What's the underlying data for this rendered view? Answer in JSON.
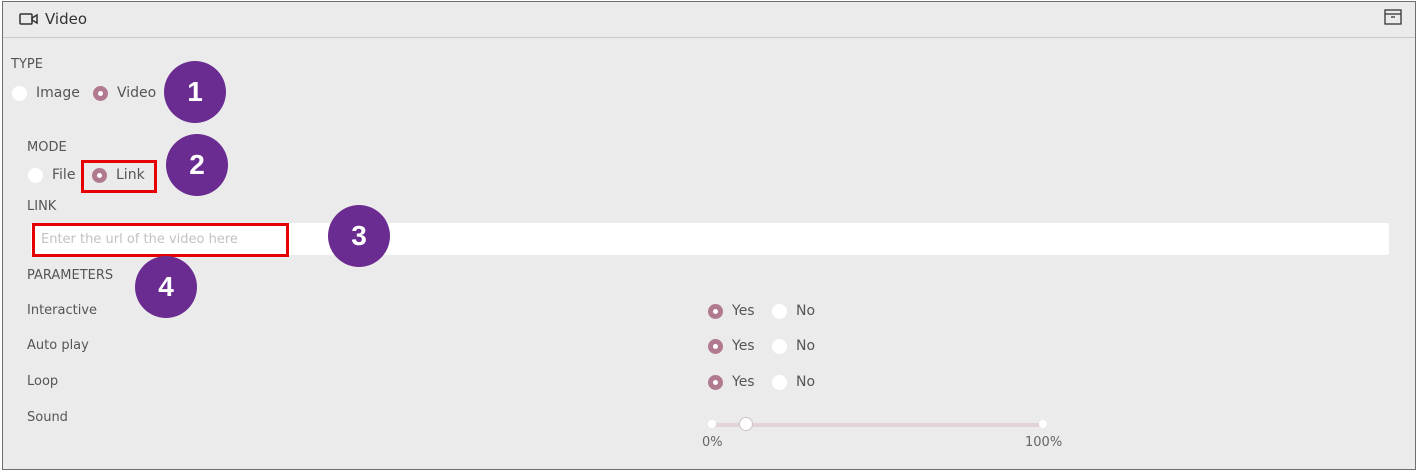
{
  "header": {
    "title": "Video",
    "icon": "video-camera-icon",
    "action_icon": "archive-icon"
  },
  "type": {
    "label": "TYPE",
    "options": [
      {
        "label": "Image",
        "selected": false
      },
      {
        "label": "Video",
        "selected": true
      }
    ]
  },
  "mode": {
    "label": "MODE",
    "options": [
      {
        "label": "File",
        "selected": false
      },
      {
        "label": "Link",
        "selected": true
      }
    ]
  },
  "link": {
    "label": "LINK",
    "placeholder": "Enter the url of the video here",
    "value": ""
  },
  "parameters": {
    "label": "PARAMETERS",
    "rows": [
      {
        "label": "Interactive",
        "yes": "Yes",
        "no": "No",
        "selected": "Yes"
      },
      {
        "label": "Auto play",
        "yes": "Yes",
        "no": "No",
        "selected": "Yes"
      },
      {
        "label": "Loop",
        "yes": "Yes",
        "no": "No",
        "selected": "Yes"
      }
    ],
    "sound": {
      "label": "Sound",
      "min_label": "0%",
      "max_label": "100%",
      "value_fraction": 0.1
    }
  },
  "annotations": [
    "1",
    "2",
    "3",
    "4"
  ],
  "colors": {
    "accent": "#b27a90",
    "badge": "#6a2c91",
    "highlight": "#e60000"
  }
}
